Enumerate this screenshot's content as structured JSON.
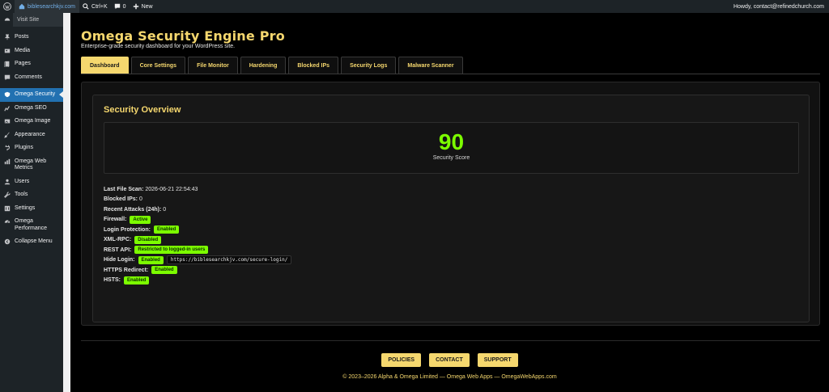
{
  "adminbar": {
    "site_name": "biblesearchkjv.com",
    "search_shortcut": "Ctrl+K",
    "comments_count": "0",
    "new_label": "New",
    "greeting": "Howdy, contact@refinedchurch.com",
    "visit_site": "Visit Site"
  },
  "sidebar": {
    "items": [
      {
        "label": "Posts",
        "icon": "pin-icon"
      },
      {
        "label": "Media",
        "icon": "media-icon"
      },
      {
        "label": "Pages",
        "icon": "pages-icon"
      },
      {
        "label": "Comments",
        "icon": "comments-icon"
      },
      {
        "label": "Omega Security",
        "icon": "shield-icon"
      },
      {
        "label": "Omega SEO",
        "icon": "chart-icon"
      },
      {
        "label": "Omega Image",
        "icon": "image-icon"
      },
      {
        "label": "Appearance",
        "icon": "brush-icon"
      },
      {
        "label": "Plugins",
        "icon": "plug-icon"
      },
      {
        "label": "Omega Web Metrics",
        "icon": "metrics-icon"
      },
      {
        "label": "Users",
        "icon": "users-icon"
      },
      {
        "label": "Tools",
        "icon": "wrench-icon"
      },
      {
        "label": "Settings",
        "icon": "settings-icon"
      },
      {
        "label": "Omega Performance",
        "icon": "gauge-icon"
      },
      {
        "label": "Collapse Menu",
        "icon": "collapse-icon"
      }
    ]
  },
  "page": {
    "title": "Omega Security Engine Pro",
    "subtitle": "Enterprise-grade security dashboard for your WordPress site."
  },
  "tabs": [
    "Dashboard",
    "Core Settings",
    "File Monitor",
    "Hardening",
    "Blocked IPs",
    "Security Logs",
    "Malware Scanner"
  ],
  "overview": {
    "title": "Security Overview",
    "score": "90",
    "score_label": "Security Score",
    "last_scan_label": "Last File Scan:",
    "last_scan_value": "2026-06-21 22:54:43",
    "blocked_ips_label": "Blocked IPs:",
    "blocked_ips_value": "0",
    "recent_attacks_label": "Recent Attacks (24h):",
    "recent_attacks_value": "0",
    "firewall_label": "Firewall:",
    "firewall_badge": "Active",
    "login_protection_label": "Login Protection:",
    "login_protection_badge": "Enabled",
    "xmlrpc_label": "XML-RPC:",
    "xmlrpc_badge": "Disabled",
    "rest_label": "REST API:",
    "rest_badge": "Restricted to logged-in users",
    "hide_login_label": "Hide Login:",
    "hide_login_badge": "Enabled",
    "hide_login_url": "https://biblesearchkjv.com/secure-login/",
    "https_label": "HTTPS Redirect:",
    "https_badge": "Enabled",
    "hsts_label": "HSTS:",
    "hsts_badge": "Enabled"
  },
  "footer": {
    "buttons": [
      "POLICIES",
      "CONTACT",
      "SUPPORT"
    ],
    "copyright": "© 2023–2026 Alpha & Omega Limited — Omega Web Apps — OmegaWebApps.com"
  },
  "colors": {
    "accent": "#f5d76e",
    "success": "#7cfc00",
    "wp_blue": "#2271b1"
  }
}
